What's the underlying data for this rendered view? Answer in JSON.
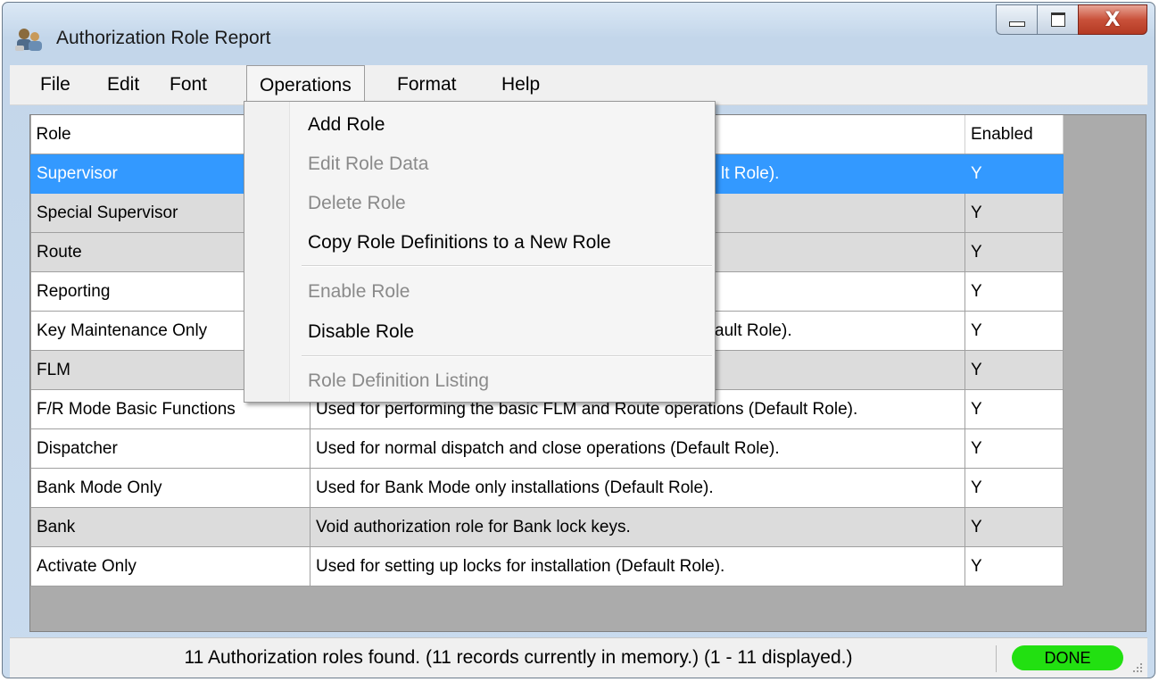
{
  "window": {
    "title": "Authorization Role Report",
    "icon": "users-keys-icon",
    "controls": {
      "minimize": "minimize-icon",
      "maximize": "maximize-icon",
      "close_glyph": "X"
    }
  },
  "menubar": {
    "items": [
      {
        "label": "File"
      },
      {
        "label": "Edit"
      },
      {
        "label": "Font"
      },
      {
        "label": "Operations"
      },
      {
        "label": "Format"
      },
      {
        "label": "Help"
      }
    ],
    "open_menu": "Operations"
  },
  "operations_menu": {
    "items": [
      {
        "label": "Add Role",
        "enabled": true
      },
      {
        "label": "Edit Role Data",
        "enabled": false
      },
      {
        "label": "Delete Role",
        "enabled": false
      },
      {
        "label": "Copy Role Definitions to a New Role",
        "enabled": true
      },
      {
        "label": "Enable Role",
        "enabled": false
      },
      {
        "label": "Disable Role",
        "enabled": true
      },
      {
        "label": "Role Definition Listing",
        "enabled": false
      }
    ]
  },
  "table": {
    "columns": [
      "Role",
      "",
      "Enabled"
    ],
    "rows": [
      {
        "role": "Supervisor",
        "description": "lt Role).",
        "enabled": "Y",
        "selected": true
      },
      {
        "role": "Special Supervisor",
        "description": "",
        "enabled": "Y"
      },
      {
        "role": "Route",
        "description": "",
        "enabled": "Y"
      },
      {
        "role": "Reporting",
        "description": "",
        "enabled": "Y"
      },
      {
        "role": "Key Maintenance Only",
        "description": "ault Role).",
        "enabled": "Y"
      },
      {
        "role": "FLM",
        "description": "",
        "enabled": "Y"
      },
      {
        "role": "F/R Mode Basic Functions",
        "description": "Used for performing the basic FLM and Route operations (Default Role).",
        "enabled": "Y"
      },
      {
        "role": "Dispatcher",
        "description": "Used for normal dispatch and close operations (Default Role).",
        "enabled": "Y"
      },
      {
        "role": "Bank Mode Only",
        "description": "Used for Bank Mode only installations (Default Role).",
        "enabled": "Y"
      },
      {
        "role": "Bank",
        "description": "Void authorization role for Bank lock keys.",
        "enabled": "Y"
      },
      {
        "role": "Activate Only",
        "description": "Used for setting up locks for installation (Default Role).",
        "enabled": "Y"
      }
    ]
  },
  "status": {
    "text": "11 Authorization roles found.  (11 records currently in memory.)  (1 - 11 displayed.)",
    "badge": "DONE",
    "badge_color": "#22e011"
  },
  "colors": {
    "selection": "#3399ff",
    "alt_row": "#dcdcdc",
    "grid_background": "#ababab"
  }
}
